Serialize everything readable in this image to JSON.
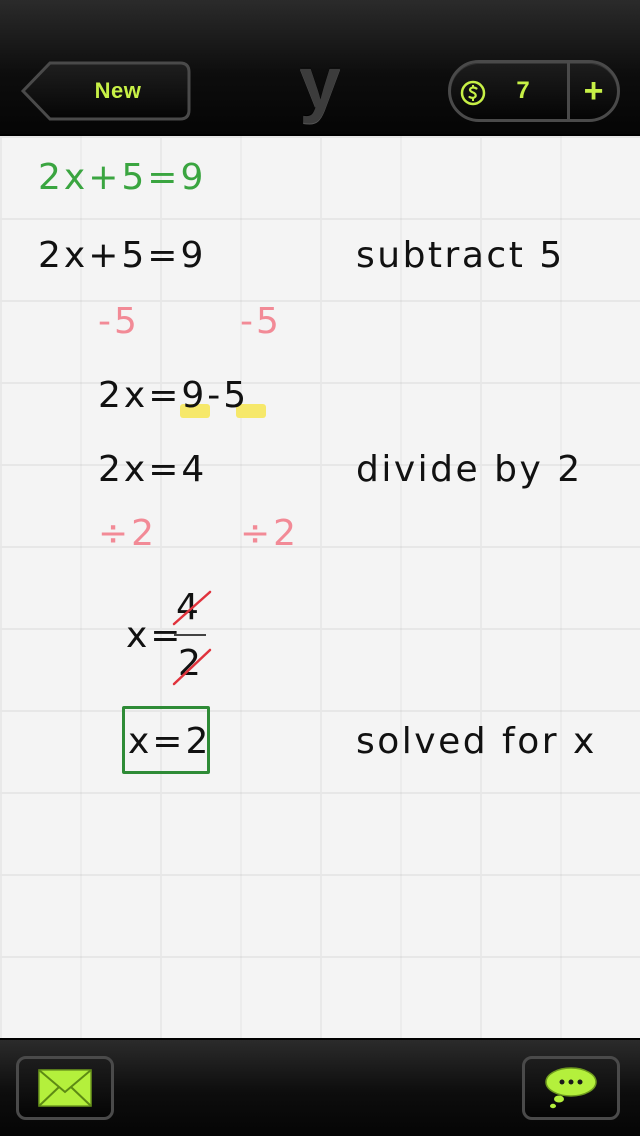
{
  "toolbar": {
    "new_label": "New",
    "logo": "y",
    "credits_count": "7",
    "add_label": "+"
  },
  "board": {
    "problem": "2x+5=9",
    "steps": [
      {
        "work": "2x+5=9",
        "note": "subtract 5"
      },
      {
        "left_op": "-5",
        "right_op": "-5"
      },
      {
        "work": "2x=9-5"
      },
      {
        "work": "2x=4",
        "note": "divide by 2"
      },
      {
        "left_op": "÷2",
        "right_op": "÷2"
      },
      {
        "lhs": "x=",
        "numerator": "4",
        "denominator": "2"
      },
      {
        "work": "x=2",
        "note": "solved for x"
      }
    ]
  },
  "colors": {
    "accent": "#c7f046",
    "problem_green": "#3aa540",
    "operation_pink": "#f28a96",
    "highlight_yellow": "#f6e86a",
    "strike_red": "#e0323c",
    "box_green": "#2e8b36"
  },
  "icons": {
    "coin": "coin-icon",
    "mail": "mail-icon",
    "chat": "chat-bubble-icon"
  }
}
